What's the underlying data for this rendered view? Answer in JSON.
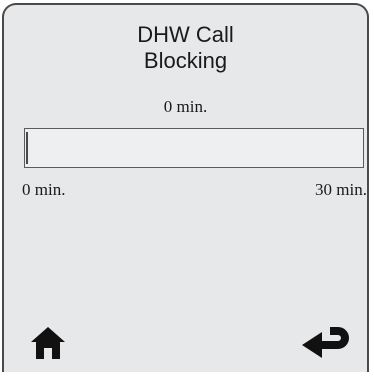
{
  "screen": {
    "title_line1": "DHW Call",
    "title_line2": "Blocking",
    "current_value": "0 min."
  },
  "progress": {
    "min_label": "0 min.",
    "max_label": "30 min.",
    "value_minutes": 0,
    "max_minutes": 30
  },
  "nav": {
    "home_icon": "home-icon",
    "back_icon": "return-arrow-icon"
  },
  "colors": {
    "background": "#e7e8ea",
    "foreground": "#1a1a1a",
    "border": "#4a4a4a"
  }
}
